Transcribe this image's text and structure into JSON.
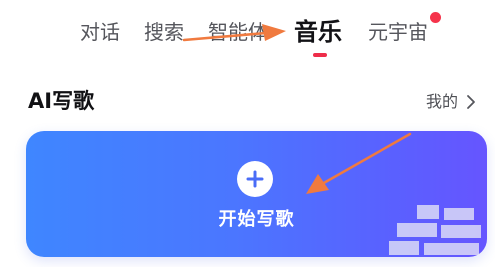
{
  "tabs": [
    {
      "label": "对话"
    },
    {
      "label": "搜索"
    },
    {
      "label": "智能体"
    },
    {
      "label": "音乐",
      "active": true
    },
    {
      "label": "元宇宙",
      "has_notification": true
    }
  ],
  "section": {
    "title": "AI写歌",
    "mine_link": "我的"
  },
  "create_card": {
    "label": "开始写歌",
    "icon": "plus-icon"
  },
  "colors": {
    "active_tab_indicator": "#ee2d4a",
    "notification_dot": "#f5334b",
    "card_gradient_start": "#3f86ff",
    "card_gradient_end": "#6655ff",
    "annotation_arrow": "#f07a3f"
  }
}
